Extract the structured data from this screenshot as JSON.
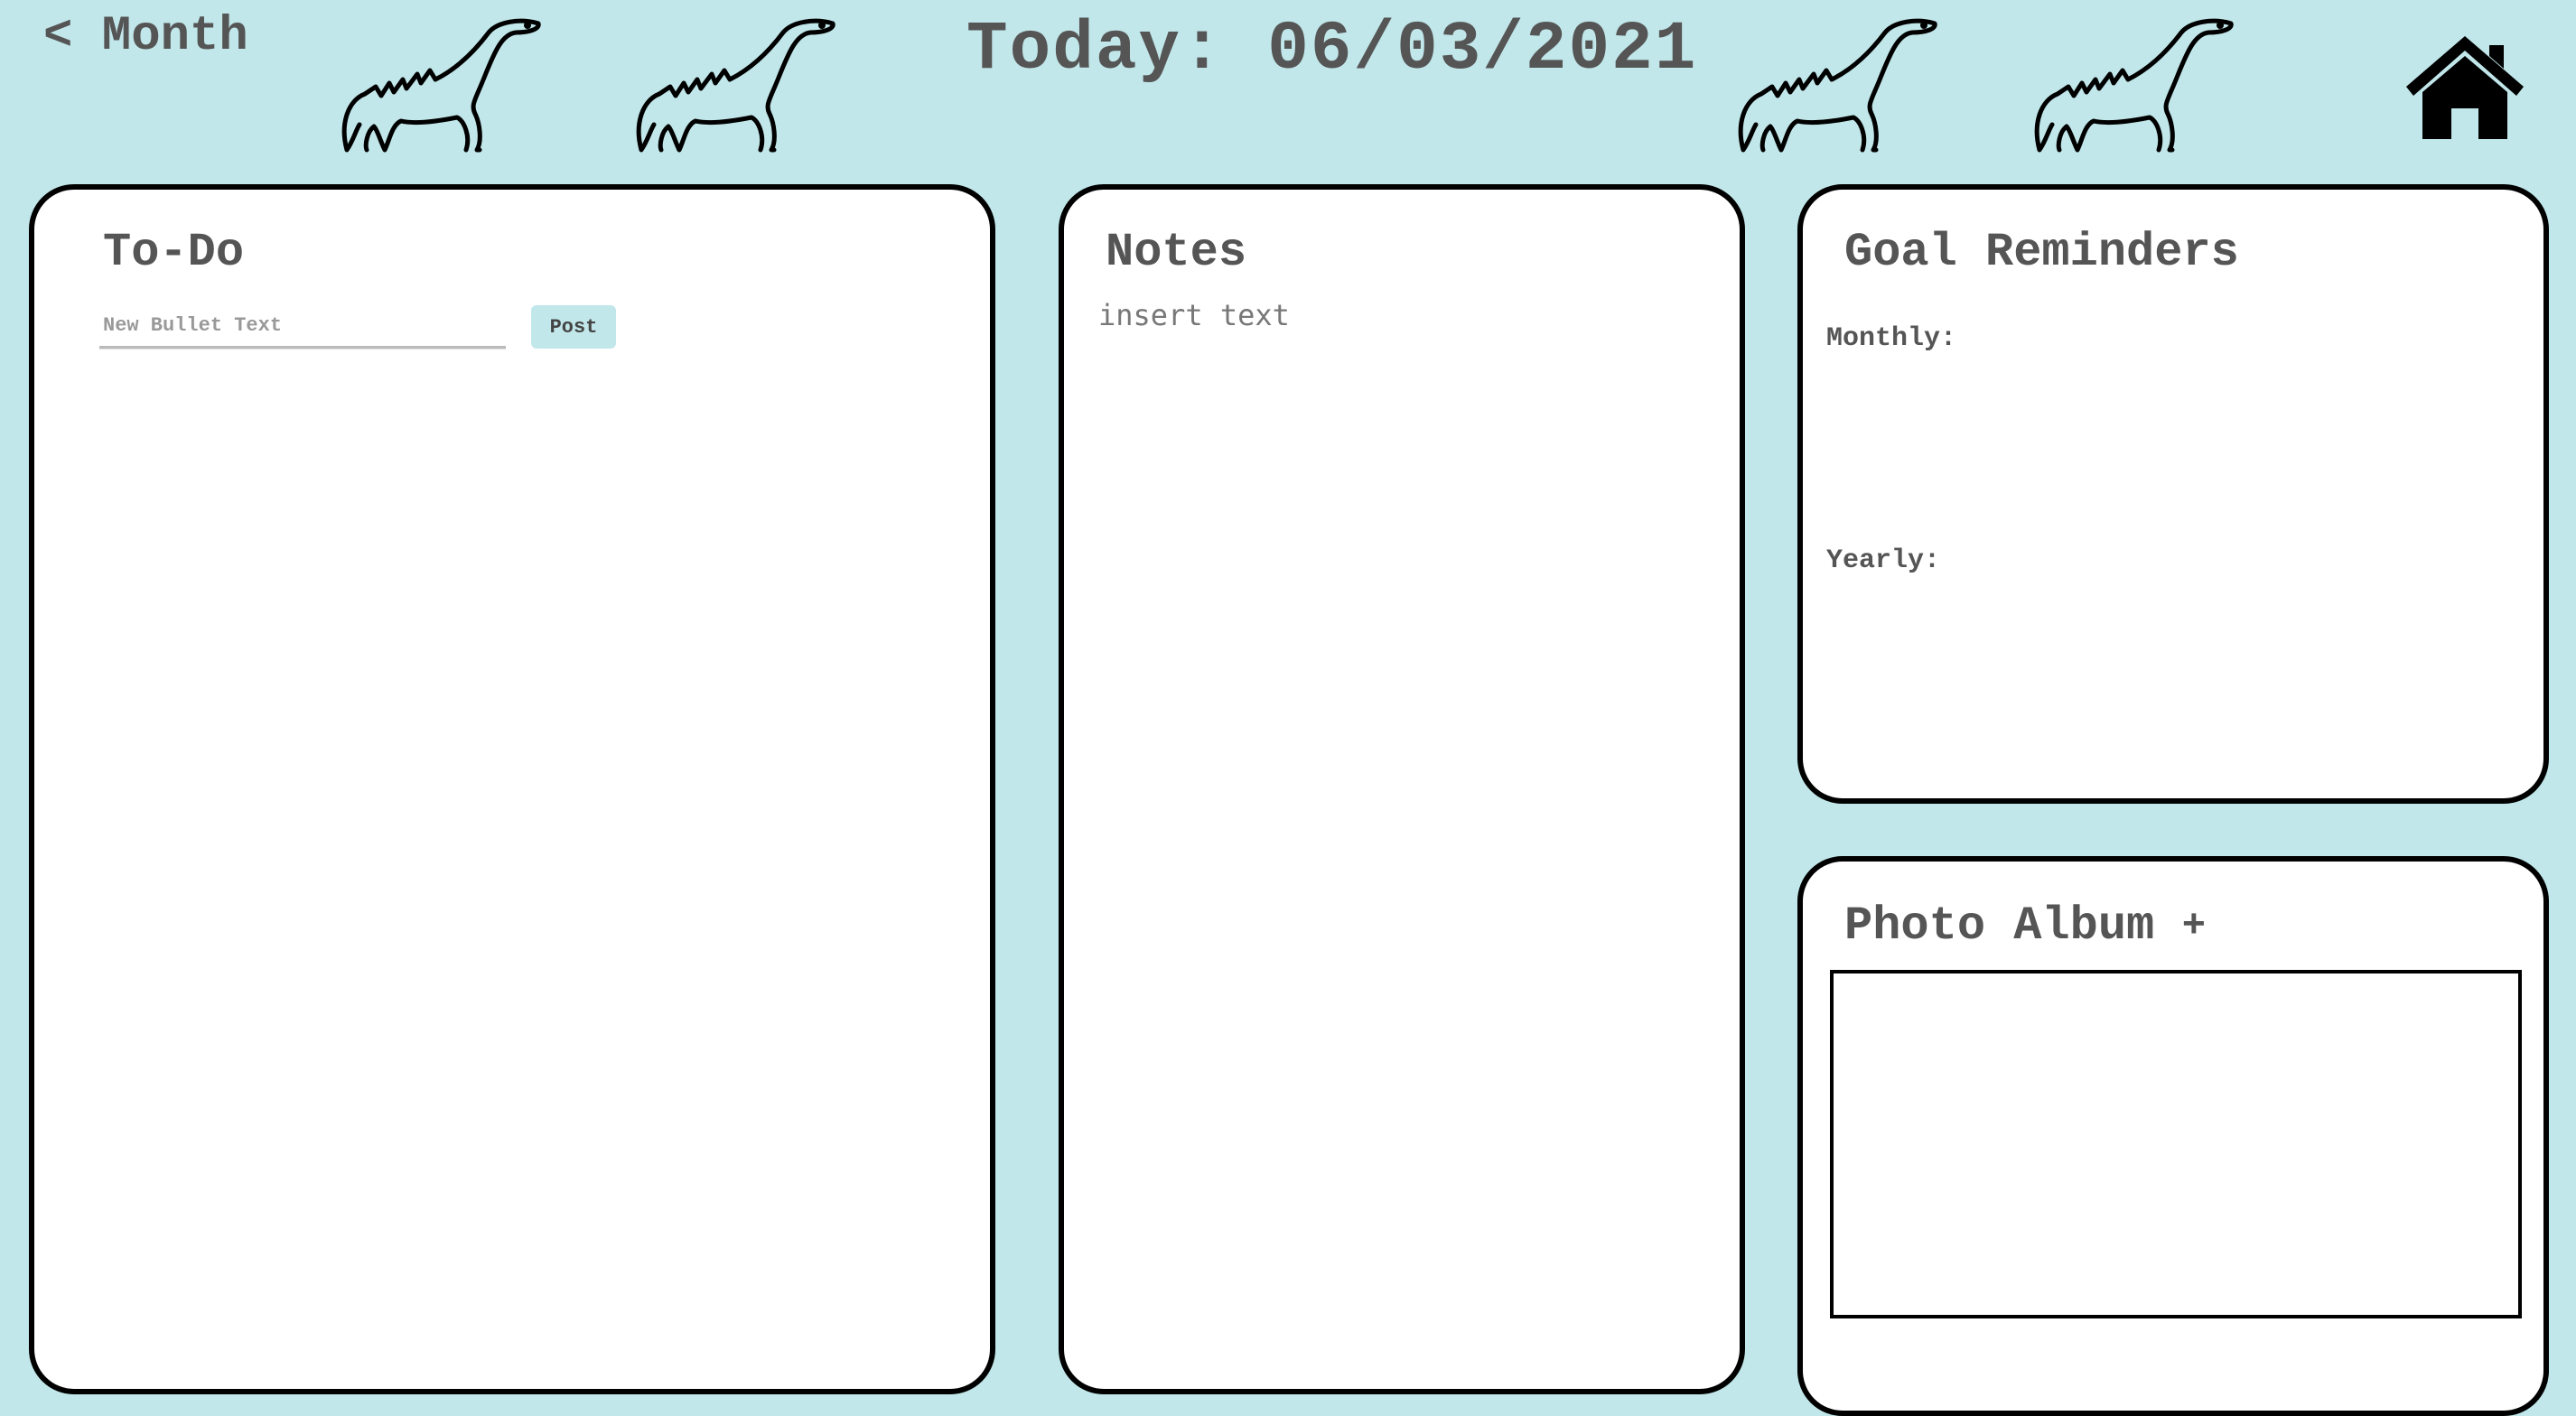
{
  "header": {
    "back_label": "< Month",
    "title_prefix": "Today:",
    "title_date": "06/03/2021"
  },
  "icons": {
    "decor": "dinosaur-icon",
    "home": "home-icon"
  },
  "todo": {
    "title": "To-Do",
    "input_placeholder": "New Bullet Text",
    "input_value": "",
    "post_label": "Post"
  },
  "notes": {
    "title": "Notes",
    "body": "insert text"
  },
  "goals": {
    "title": "Goal Reminders",
    "monthly_label": "Monthly:",
    "yearly_label": "Yearly:"
  },
  "photos": {
    "title": "Photo Album",
    "add_label": "+"
  },
  "colors": {
    "background": "#c1e7ea",
    "panel": "#ffffff",
    "border": "#000000",
    "text": "#555555",
    "button": "#c1e7ea"
  }
}
